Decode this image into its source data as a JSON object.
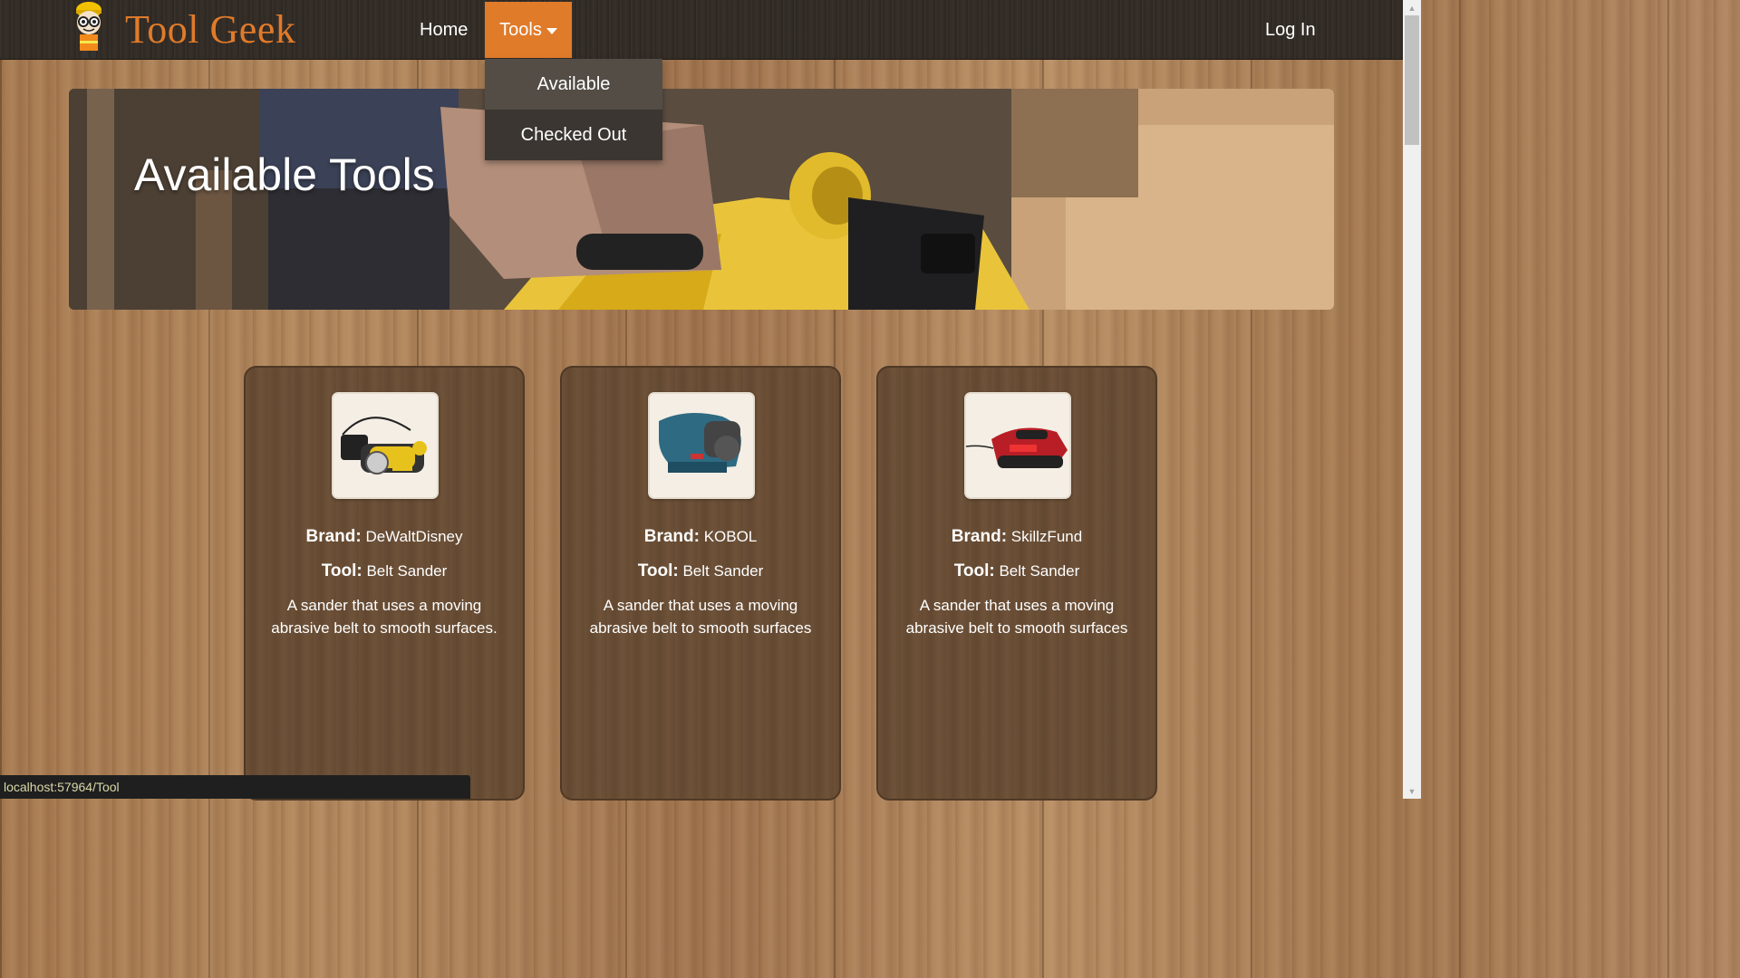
{
  "navbar": {
    "brand": "Tool Geek",
    "home": "Home",
    "tools": "Tools",
    "login": "Log In",
    "accent": "#e07b2a"
  },
  "dropdown": {
    "items": [
      "Available",
      "Checked Out"
    ]
  },
  "hero": {
    "title": "Available Tools"
  },
  "cards": [
    {
      "brand_label": "Brand:",
      "brand": "DeWaltDisney",
      "tool_label": "Tool:",
      "tool": "Belt Sander",
      "description": "A sander that uses a moving abrasive belt to smooth surfaces."
    },
    {
      "brand_label": "Brand:",
      "brand": "KOBOL",
      "tool_label": "Tool:",
      "tool": "Belt Sander",
      "description": "A sander that uses a moving abrasive belt to smooth surfaces"
    },
    {
      "brand_label": "Brand:",
      "brand": "SkillzFund",
      "tool_label": "Tool:",
      "tool": "Belt Sander",
      "description": "A sander that uses a moving abrasive belt to smooth surfaces"
    }
  ],
  "statusbar": {
    "url": "localhost:57964/Tool"
  }
}
